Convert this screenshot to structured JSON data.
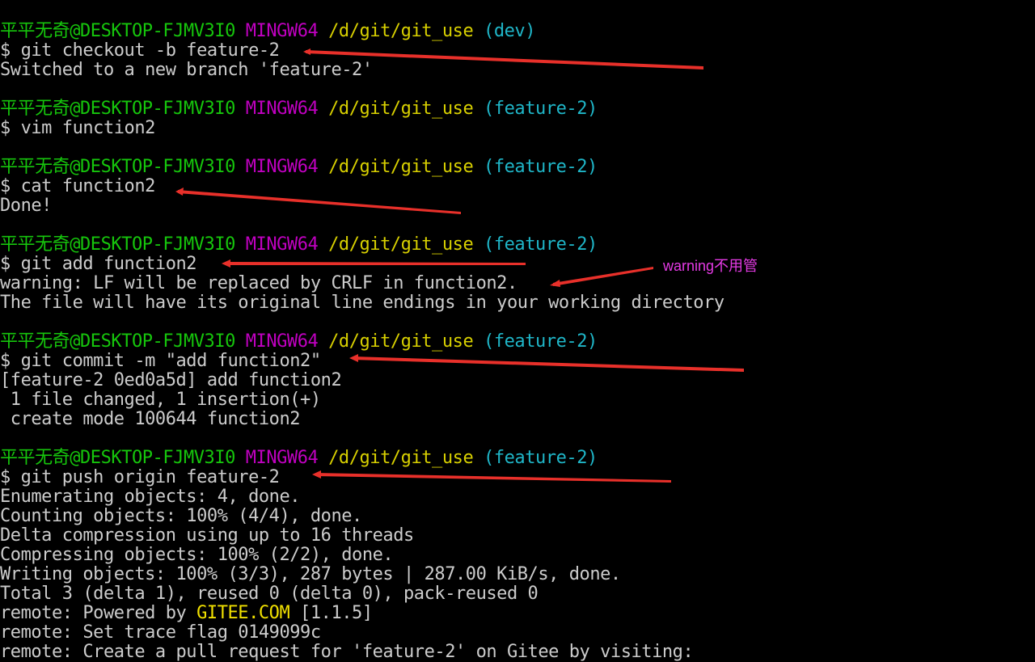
{
  "prompt": {
    "user": "平平无奇@DESKTOP-FJMV3I0",
    "shell": "MINGW64",
    "path": "/d/git/git_use"
  },
  "blocks": [
    {
      "branch": "(dev)",
      "command": "$ git checkout -b feature-2",
      "output": [
        "Switched to a new branch 'feature-2'"
      ]
    },
    {
      "branch": "(feature-2)",
      "command": "$ vim function2",
      "output": []
    },
    {
      "branch": "(feature-2)",
      "command": "$ cat function2",
      "output": [
        "Done!"
      ]
    },
    {
      "branch": "(feature-2)",
      "command": "$ git add function2",
      "output": [
        "warning: LF will be replaced by CRLF in function2.",
        "The file will have its original line endings in your working directory"
      ]
    },
    {
      "branch": "(feature-2)",
      "command": "$ git commit -m \"add function2\"",
      "output": [
        "[feature-2 0ed0a5d] add function2",
        " 1 file changed, 1 insertion(+)",
        " create mode 100644 function2"
      ]
    },
    {
      "branch": "(feature-2)",
      "command": "$ git push origin feature-2",
      "output": [
        "Enumerating objects: 4, done.",
        "Counting objects: 100% (4/4), done.",
        "Delta compression using up to 16 threads",
        "Compressing objects: 100% (2/2), done.",
        "Writing objects: 100% (3/3), 287 bytes | 287.00 KiB/s, done.",
        "Total 3 (delta 1), reused 0 (delta 0), pack-reused 0",
        "remote: Powered by GITEE.COM [1.1.5]",
        "remote: Set trace flag 0149099c",
        "remote: Create a pull request for 'feature-2' on Gitee by visiting:"
      ]
    }
  ],
  "annotation": {
    "note": "warning不用管",
    "color": "#e53ae5",
    "arrow_color": "#e8302a"
  },
  "colors": {
    "background": "#000000",
    "text": "#cccccc",
    "user": "#16c60c",
    "shell": "#c000c0",
    "path": "#d8d000",
    "branch": "#1fb6c8",
    "highlight": "#f0e000"
  }
}
